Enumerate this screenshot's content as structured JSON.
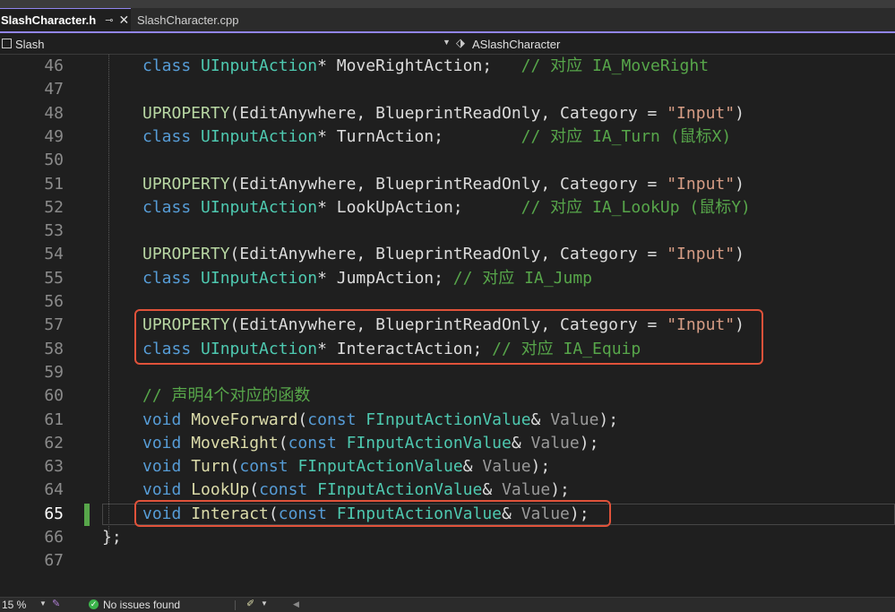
{
  "tabs": [
    {
      "label": "SlashCharacter.h",
      "active": true
    },
    {
      "label": "SlashCharacter.cpp",
      "active": false
    }
  ],
  "icons": {
    "tab_pin": "pin-icon",
    "tab_close": "close-icon",
    "project": "project-icon",
    "class_scope": "class-scope-icon",
    "status_ok": "check-circle-icon"
  },
  "navbar": {
    "project": "Slash",
    "scope": "ASlashCharacter"
  },
  "editor": {
    "current_line": 65,
    "lines": [
      {
        "num": "46",
        "tokens": [
          [
            "k",
            "class"
          ],
          [
            "p",
            " "
          ],
          [
            "t",
            "UInputAction"
          ],
          [
            "i",
            "* MoveRightAction;   "
          ],
          [
            "c",
            "// 对应 IA_MoveRight"
          ]
        ]
      },
      {
        "num": "47",
        "tokens": []
      },
      {
        "num": "48",
        "tokens": [
          [
            "m",
            "UPROPERTY"
          ],
          [
            "i",
            "(EditAnywhere, BlueprintReadOnly, Category = "
          ],
          [
            "s",
            "\"Input\""
          ],
          [
            "i",
            ")"
          ]
        ]
      },
      {
        "num": "49",
        "tokens": [
          [
            "k",
            "class"
          ],
          [
            "p",
            " "
          ],
          [
            "t",
            "UInputAction"
          ],
          [
            "i",
            "* TurnAction;        "
          ],
          [
            "c",
            "// 对应 IA_Turn (鼠标X)"
          ]
        ]
      },
      {
        "num": "50",
        "tokens": []
      },
      {
        "num": "51",
        "tokens": [
          [
            "m",
            "UPROPERTY"
          ],
          [
            "i",
            "(EditAnywhere, BlueprintReadOnly, Category = "
          ],
          [
            "s",
            "\"Input\""
          ],
          [
            "i",
            ")"
          ]
        ]
      },
      {
        "num": "52",
        "tokens": [
          [
            "k",
            "class"
          ],
          [
            "p",
            " "
          ],
          [
            "t",
            "UInputAction"
          ],
          [
            "i",
            "* LookUpAction;      "
          ],
          [
            "c",
            "// 对应 IA_LookUp (鼠标Y)"
          ]
        ]
      },
      {
        "num": "53",
        "tokens": []
      },
      {
        "num": "54",
        "tokens": [
          [
            "m",
            "UPROPERTY"
          ],
          [
            "i",
            "(EditAnywhere, BlueprintReadOnly, Category = "
          ],
          [
            "s",
            "\"Input\""
          ],
          [
            "i",
            ")"
          ]
        ]
      },
      {
        "num": "55",
        "tokens": [
          [
            "k",
            "class"
          ],
          [
            "p",
            " "
          ],
          [
            "t",
            "UInputAction"
          ],
          [
            "i",
            "* JumpAction; "
          ],
          [
            "c",
            "// 对应 IA_Jump"
          ]
        ]
      },
      {
        "num": "56",
        "tokens": []
      },
      {
        "num": "57",
        "tokens": [
          [
            "m",
            "UPROPERTY"
          ],
          [
            "i",
            "(EditAnywhere, BlueprintReadOnly, Category = "
          ],
          [
            "s",
            "\"Input\""
          ],
          [
            "i",
            ")"
          ]
        ]
      },
      {
        "num": "58",
        "tokens": [
          [
            "k",
            "class"
          ],
          [
            "p",
            " "
          ],
          [
            "t",
            "UInputAction"
          ],
          [
            "i",
            "* InteractAction; "
          ],
          [
            "c",
            "// 对应 IA_Equip"
          ]
        ]
      },
      {
        "num": "59",
        "tokens": []
      },
      {
        "num": "60",
        "tokens": [
          [
            "c",
            "// 声明4个对应的函数"
          ]
        ]
      },
      {
        "num": "61",
        "tokens": [
          [
            "k",
            "void"
          ],
          [
            "p",
            " "
          ],
          [
            "f",
            "MoveForward"
          ],
          [
            "i",
            "("
          ],
          [
            "k",
            "const"
          ],
          [
            "p",
            " "
          ],
          [
            "t",
            "FInputActionValue"
          ],
          [
            "i",
            "& "
          ],
          [
            "p",
            "Value"
          ],
          [
            "i",
            ");"
          ]
        ]
      },
      {
        "num": "62",
        "tokens": [
          [
            "k",
            "void"
          ],
          [
            "p",
            " "
          ],
          [
            "f",
            "MoveRight"
          ],
          [
            "i",
            "("
          ],
          [
            "k",
            "const"
          ],
          [
            "p",
            " "
          ],
          [
            "t",
            "FInputActionValue"
          ],
          [
            "i",
            "& "
          ],
          [
            "p",
            "Value"
          ],
          [
            "i",
            ");"
          ]
        ]
      },
      {
        "num": "63",
        "tokens": [
          [
            "k",
            "void"
          ],
          [
            "p",
            " "
          ],
          [
            "f",
            "Turn"
          ],
          [
            "i",
            "("
          ],
          [
            "k",
            "const"
          ],
          [
            "p",
            " "
          ],
          [
            "t",
            "FInputActionValue"
          ],
          [
            "i",
            "& "
          ],
          [
            "p",
            "Value"
          ],
          [
            "i",
            ");"
          ]
        ]
      },
      {
        "num": "64",
        "tokens": [
          [
            "k",
            "void"
          ],
          [
            "p",
            " "
          ],
          [
            "f",
            "LookUp"
          ],
          [
            "i",
            "("
          ],
          [
            "k",
            "const"
          ],
          [
            "p",
            " "
          ],
          [
            "t",
            "FInputActionValue"
          ],
          [
            "i",
            "& "
          ],
          [
            "p",
            "Value"
          ],
          [
            "i",
            ");"
          ]
        ]
      },
      {
        "num": "65",
        "tokens": [
          [
            "k",
            "void"
          ],
          [
            "p",
            " "
          ],
          [
            "f",
            "Interact"
          ],
          [
            "i",
            "("
          ],
          [
            "k",
            "const"
          ],
          [
            "p",
            " "
          ],
          [
            "t",
            "FInputActionValue"
          ],
          [
            "i",
            "& "
          ],
          [
            "p",
            "Value"
          ],
          [
            "i",
            ");"
          ]
        ]
      },
      {
        "num": "66",
        "tokens": [
          [
            "i",
            "};"
          ]
        ]
      },
      {
        "num": "67",
        "tokens": []
      }
    ]
  },
  "status": {
    "zoom": "15 %",
    "issues": "No issues found"
  },
  "colors": {
    "accent": "#9184ee",
    "highlight_box": "#e0523a",
    "change_marker": "#57a64a"
  }
}
